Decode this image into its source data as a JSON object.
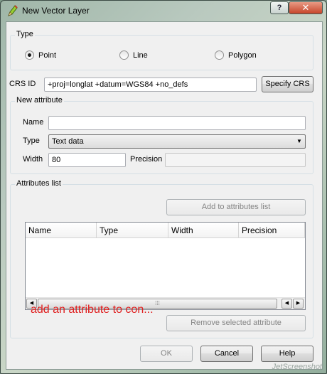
{
  "window": {
    "title": "New Vector Layer",
    "help_label": "?",
    "close_label": "✕",
    "icon": "qgis-pencil-icon"
  },
  "type_group": {
    "title": "Type",
    "options": [
      {
        "label": "Point",
        "checked": true
      },
      {
        "label": "Line",
        "checked": false
      },
      {
        "label": "Polygon",
        "checked": false
      }
    ]
  },
  "crs": {
    "label": "CRS ID",
    "value": "+proj=longlat +datum=WGS84 +no_defs",
    "button": "Specify CRS"
  },
  "new_attribute": {
    "title": "New attribute",
    "name_label": "Name",
    "name_value": "",
    "type_label": "Type",
    "type_value": "Text data",
    "width_label": "Width",
    "width_value": "80",
    "precision_label": "Precision",
    "precision_value": ""
  },
  "attributes_list": {
    "title": "Attributes list",
    "add_button": "Add to attributes list",
    "columns": [
      "Name",
      "Type",
      "Width",
      "Precision"
    ],
    "rows": [],
    "remove_button": "Remove selected attribute"
  },
  "annotation": "add an attribute to con...",
  "footer": {
    "ok": "OK",
    "cancel": "Cancel",
    "help": "Help"
  },
  "watermark": "JetScreenshot"
}
